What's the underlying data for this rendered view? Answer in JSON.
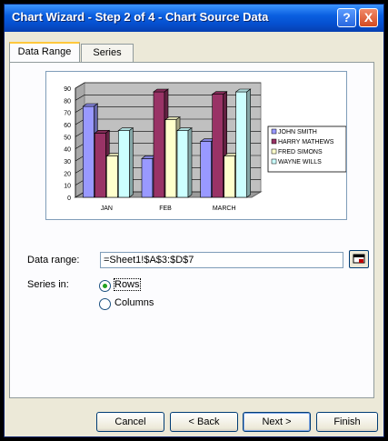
{
  "window": {
    "title": "Chart Wizard - Step 2 of 4 - Chart Source Data",
    "help_glyph": "?",
    "close_glyph": "X"
  },
  "tabs": [
    {
      "label": "Data Range",
      "active": true
    },
    {
      "label": "Series",
      "active": false
    }
  ],
  "chart_data": {
    "type": "bar",
    "categories": [
      "JAN",
      "FEB",
      "MARCH"
    ],
    "ylim": [
      0,
      90
    ],
    "yticks": [
      "0",
      "10",
      "20",
      "30",
      "40",
      "50",
      "60",
      "70",
      "80",
      "90"
    ],
    "series": [
      {
        "name": "JOHN SMITH",
        "values": [
          75,
          32,
          46
        ],
        "color": "#9999ff"
      },
      {
        "name": "HARRY MATHEWS",
        "values": [
          53,
          87,
          85
        ],
        "color": "#993366"
      },
      {
        "name": "FRED SIMONS",
        "values": [
          34,
          64,
          34
        ],
        "color": "#ffffcc"
      },
      {
        "name": "WAYNE WILLS",
        "values": [
          55,
          55,
          87
        ],
        "color": "#ccffff"
      }
    ],
    "legend_position": "right",
    "chart_3d": true,
    "grid": true
  },
  "form": {
    "data_range_label": "Data range:",
    "data_range_value": "=Sheet1!$A$3:$D$7",
    "series_in_label": "Series in:",
    "options": [
      {
        "label": "Rows",
        "selected": true
      },
      {
        "label": "Columns",
        "selected": false
      }
    ]
  },
  "buttons": {
    "cancel": "Cancel",
    "back": "< Back",
    "next": "Next >",
    "finish": "Finish"
  }
}
